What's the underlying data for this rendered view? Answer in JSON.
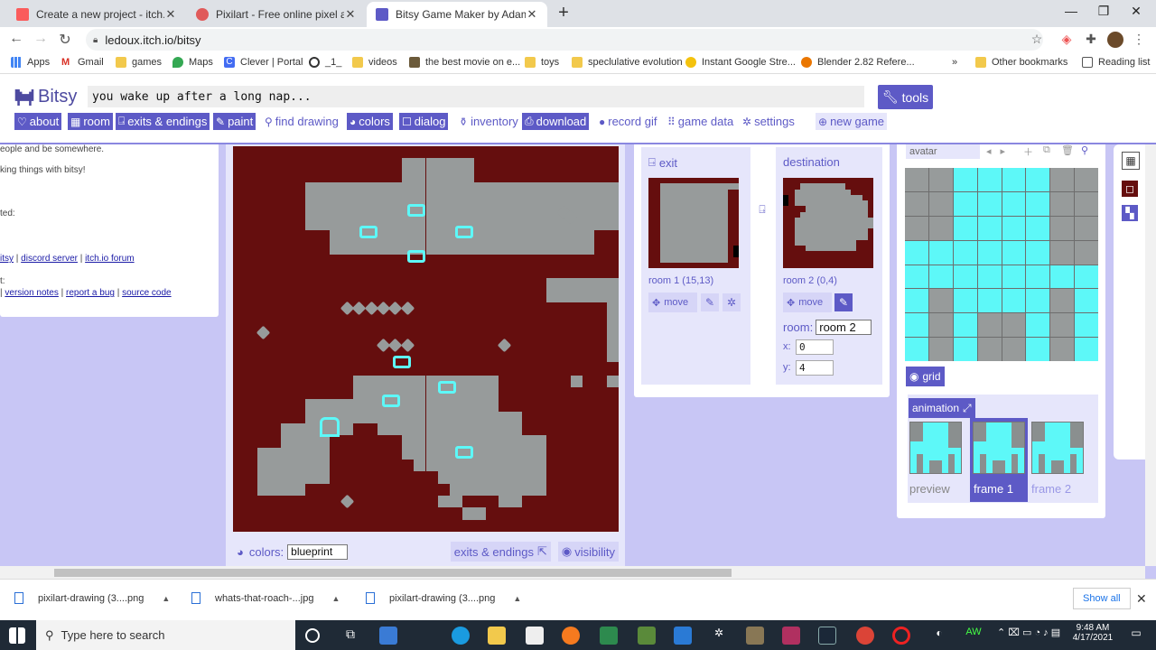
{
  "browser": {
    "tabs": [
      {
        "title": "Create a new project - itch.io",
        "active": false
      },
      {
        "title": "Pixilart - Free online pixel art dra",
        "active": false
      },
      {
        "title": "Bitsy Game Maker by Adam Le D",
        "active": true
      }
    ],
    "url": "ledoux.itch.io/bitsy",
    "bookmarks": [
      "Apps",
      "Gmail",
      "games",
      "Maps",
      "Clever | Portal",
      "_1_",
      "videos",
      "the best movie on e...",
      "toys",
      "speclulative evolution",
      "Instant Google Stre...",
      "Blender 2.82 Refere..."
    ],
    "bookmarks_more": "»",
    "other_bookmarks": "Other bookmarks",
    "reading_list": "Reading list"
  },
  "bitsy": {
    "logo": "Bitsy",
    "game_title": "you wake up after a long nap...",
    "tools_label": "tools",
    "toolbar": [
      {
        "label": "about",
        "on": true,
        "icon": "♡"
      },
      {
        "label": "room",
        "on": true,
        "icon": "▦"
      },
      {
        "label": "exits & endings",
        "on": true,
        "icon": "⍈"
      },
      {
        "label": "paint",
        "on": true,
        "icon": "✎"
      },
      {
        "label": "find drawing",
        "on": false,
        "icon": "⚲"
      },
      {
        "label": "colors",
        "on": true,
        "icon": "◕"
      },
      {
        "label": "dialog",
        "on": true,
        "icon": "☐"
      },
      {
        "label": "inventory",
        "on": false,
        "icon": "⚱"
      },
      {
        "label": "download",
        "on": true,
        "icon": "⎙"
      },
      {
        "label": "record gif",
        "on": false,
        "icon": "●"
      },
      {
        "label": "game data",
        "on": false,
        "icon": "⠿"
      },
      {
        "label": "settings",
        "on": false,
        "icon": "✲"
      }
    ],
    "new_game": "new game"
  },
  "about_panel": {
    "line1": "eople and be somewhere.",
    "line2": "king things with bitsy!",
    "line3": "ted:",
    "links1": [
      "itsy",
      "discord server",
      "itch.io forum"
    ],
    "line4": "t:",
    "links2": [
      "version notes",
      "report a bug",
      "source code"
    ]
  },
  "room_panel": {
    "colors_label": "colors:",
    "palette": "blueprint",
    "exits_link": "exits & endings",
    "visibility_link": "visibility"
  },
  "exits_panel": {
    "exit_label": "exit",
    "destination_label": "destination",
    "exit_room": "room 1 (15,13)",
    "dest_room": "room 2 (0,4)",
    "move_label": "move",
    "room_label": "room:",
    "room_value": "room 2",
    "x_label": "x:",
    "x_value": "0",
    "y_label": "y:",
    "y_value": "4"
  },
  "paint_panel": {
    "tab_name": "avatar",
    "grid_label": "grid",
    "animation_label": "animation",
    "frames": [
      "preview",
      "frame 1",
      "frame 2"
    ]
  },
  "downloads": {
    "files": [
      "pixilart-drawing (3....png",
      "whats-that-roach-...jpg",
      "pixilart-drawing (3....png"
    ],
    "show_all": "Show all"
  },
  "taskbar": {
    "search_placeholder": "Type here to search",
    "time": "9:48 AM",
    "date": "4/17/2021"
  },
  "colors": {
    "bg": "#650e0e",
    "tile": "#979b9b",
    "sprite": "#5df8f8",
    "accent": "#5d5ac6",
    "lavender": "#c8c6f5"
  }
}
